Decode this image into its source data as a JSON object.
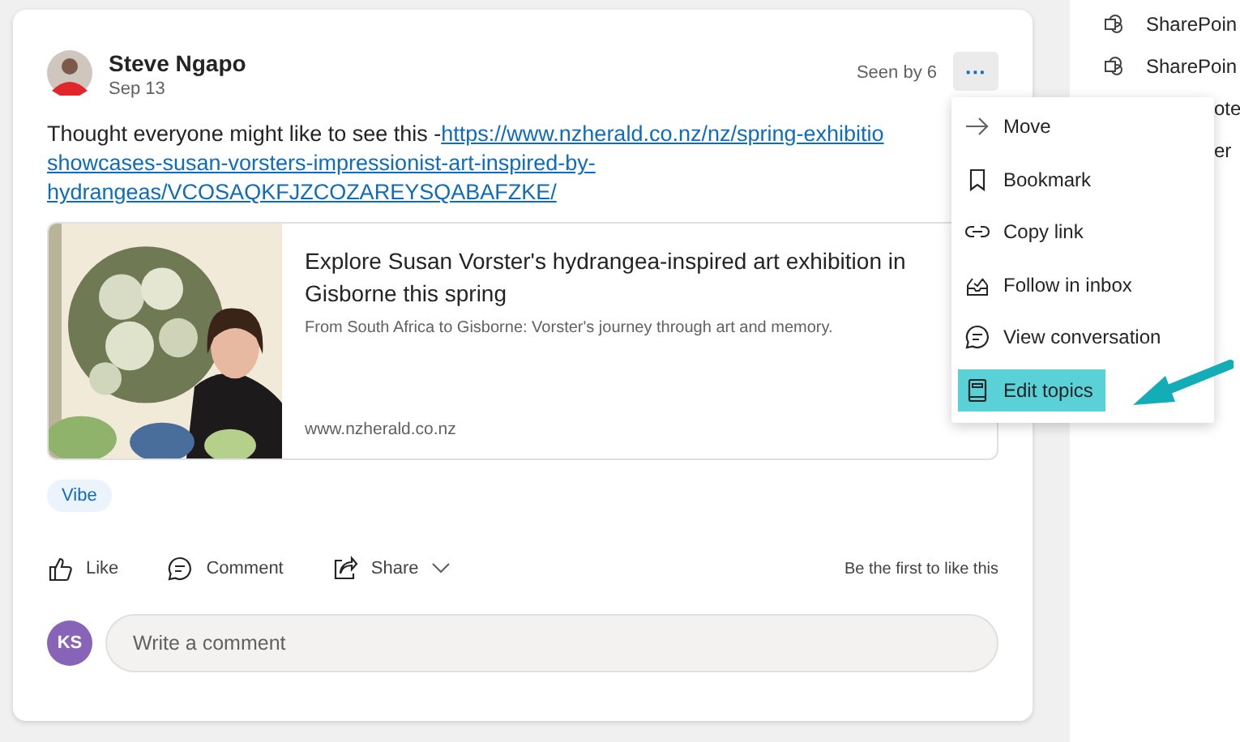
{
  "post": {
    "author": "Steve Ngapo",
    "date": "Sep 13",
    "seen": "Seen by 6",
    "more": "···",
    "text": "Thought everyone might like to see this -",
    "link_lines": [
      "https://www.nzherald.co.nz/nz/spring-exhibitio",
      "showcases-susan-vorsters-impressionist-art-inspired-by-",
      "hydrangeas/VCOSAQKFJZCOZAREYSQABAFZKE/"
    ],
    "preview": {
      "title": "Explore Susan Vorster's hydrangea-inspired art exhibition in Gisborne this spring",
      "description": "From South Africa to Gisborne: Vorster's journey through art and memory.",
      "domain": "www.nzherald.co.nz"
    },
    "topics": [
      "Vibe"
    ],
    "actions": [
      {
        "kind": "like",
        "label": "Like"
      },
      {
        "kind": "comment",
        "label": "Comment"
      },
      {
        "kind": "share",
        "label": "Share"
      }
    ],
    "likes_note": "Be the first to like this",
    "comment": {
      "avatar": "KS",
      "placeholder": "Write a comment"
    }
  },
  "side_panel": {
    "items": [
      {
        "kind": "full",
        "label": "SharePoin"
      },
      {
        "kind": "full",
        "label": "SharePoin"
      },
      {
        "kind": "clipped",
        "label": "ote"
      },
      {
        "kind": "clipped",
        "label": "er"
      }
    ]
  },
  "menu": {
    "items": [
      {
        "kind": "move",
        "label": "Move",
        "selected": false
      },
      {
        "kind": "bookmark",
        "label": "Bookmark",
        "selected": false
      },
      {
        "kind": "link",
        "label": "Copy link",
        "selected": false
      },
      {
        "kind": "inbox",
        "label": "Follow in inbox",
        "selected": false
      },
      {
        "kind": "conversation",
        "label": "View conversation",
        "selected": false
      },
      {
        "kind": "topics",
        "label": "Edit topics",
        "selected": true
      }
    ]
  }
}
